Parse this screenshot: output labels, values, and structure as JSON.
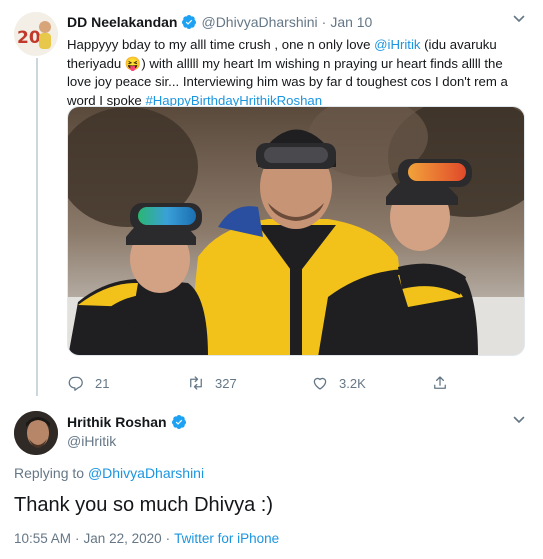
{
  "tweet1": {
    "name": "DD Neelakandan",
    "handle": "@DhivyaDharshini",
    "separator": "·",
    "date": "Jan 10",
    "text_part1": "Happyyy bday to my alll time crush , one n only love ",
    "mention": "@iHritik",
    "text_part2": " (idu avaruku theriyadu ",
    "emoji": "😝",
    "text_part3": ") with alllll my heart Im wishing n praying ur heart finds allll the love joy peace sir... Interviewing him was by far d toughest cos I don't rem a word I spoke ",
    "hashtag": "#HappyBirthdayHrithikRoshan",
    "replies": "21",
    "retweets": "327",
    "likes": "3.2K"
  },
  "tweet2": {
    "name": "Hrithik Roshan",
    "handle": "@iHritik",
    "replying_prefix": "Replying to ",
    "replying_to": "@DhivyaDharshini",
    "text": "Thank you so much Dhivya :)",
    "time": "10:55 AM",
    "separator": "·",
    "date": "Jan 22, 2020",
    "separator2": "·",
    "source": "Twitter for iPhone"
  },
  "colors": {
    "link": "#1b95e0",
    "muted": "#657786",
    "verified": "#1da1f2"
  },
  "icons": [
    "verified-badge-icon",
    "chevron-down-icon",
    "reply-icon",
    "retweet-icon",
    "like-icon",
    "share-icon"
  ]
}
